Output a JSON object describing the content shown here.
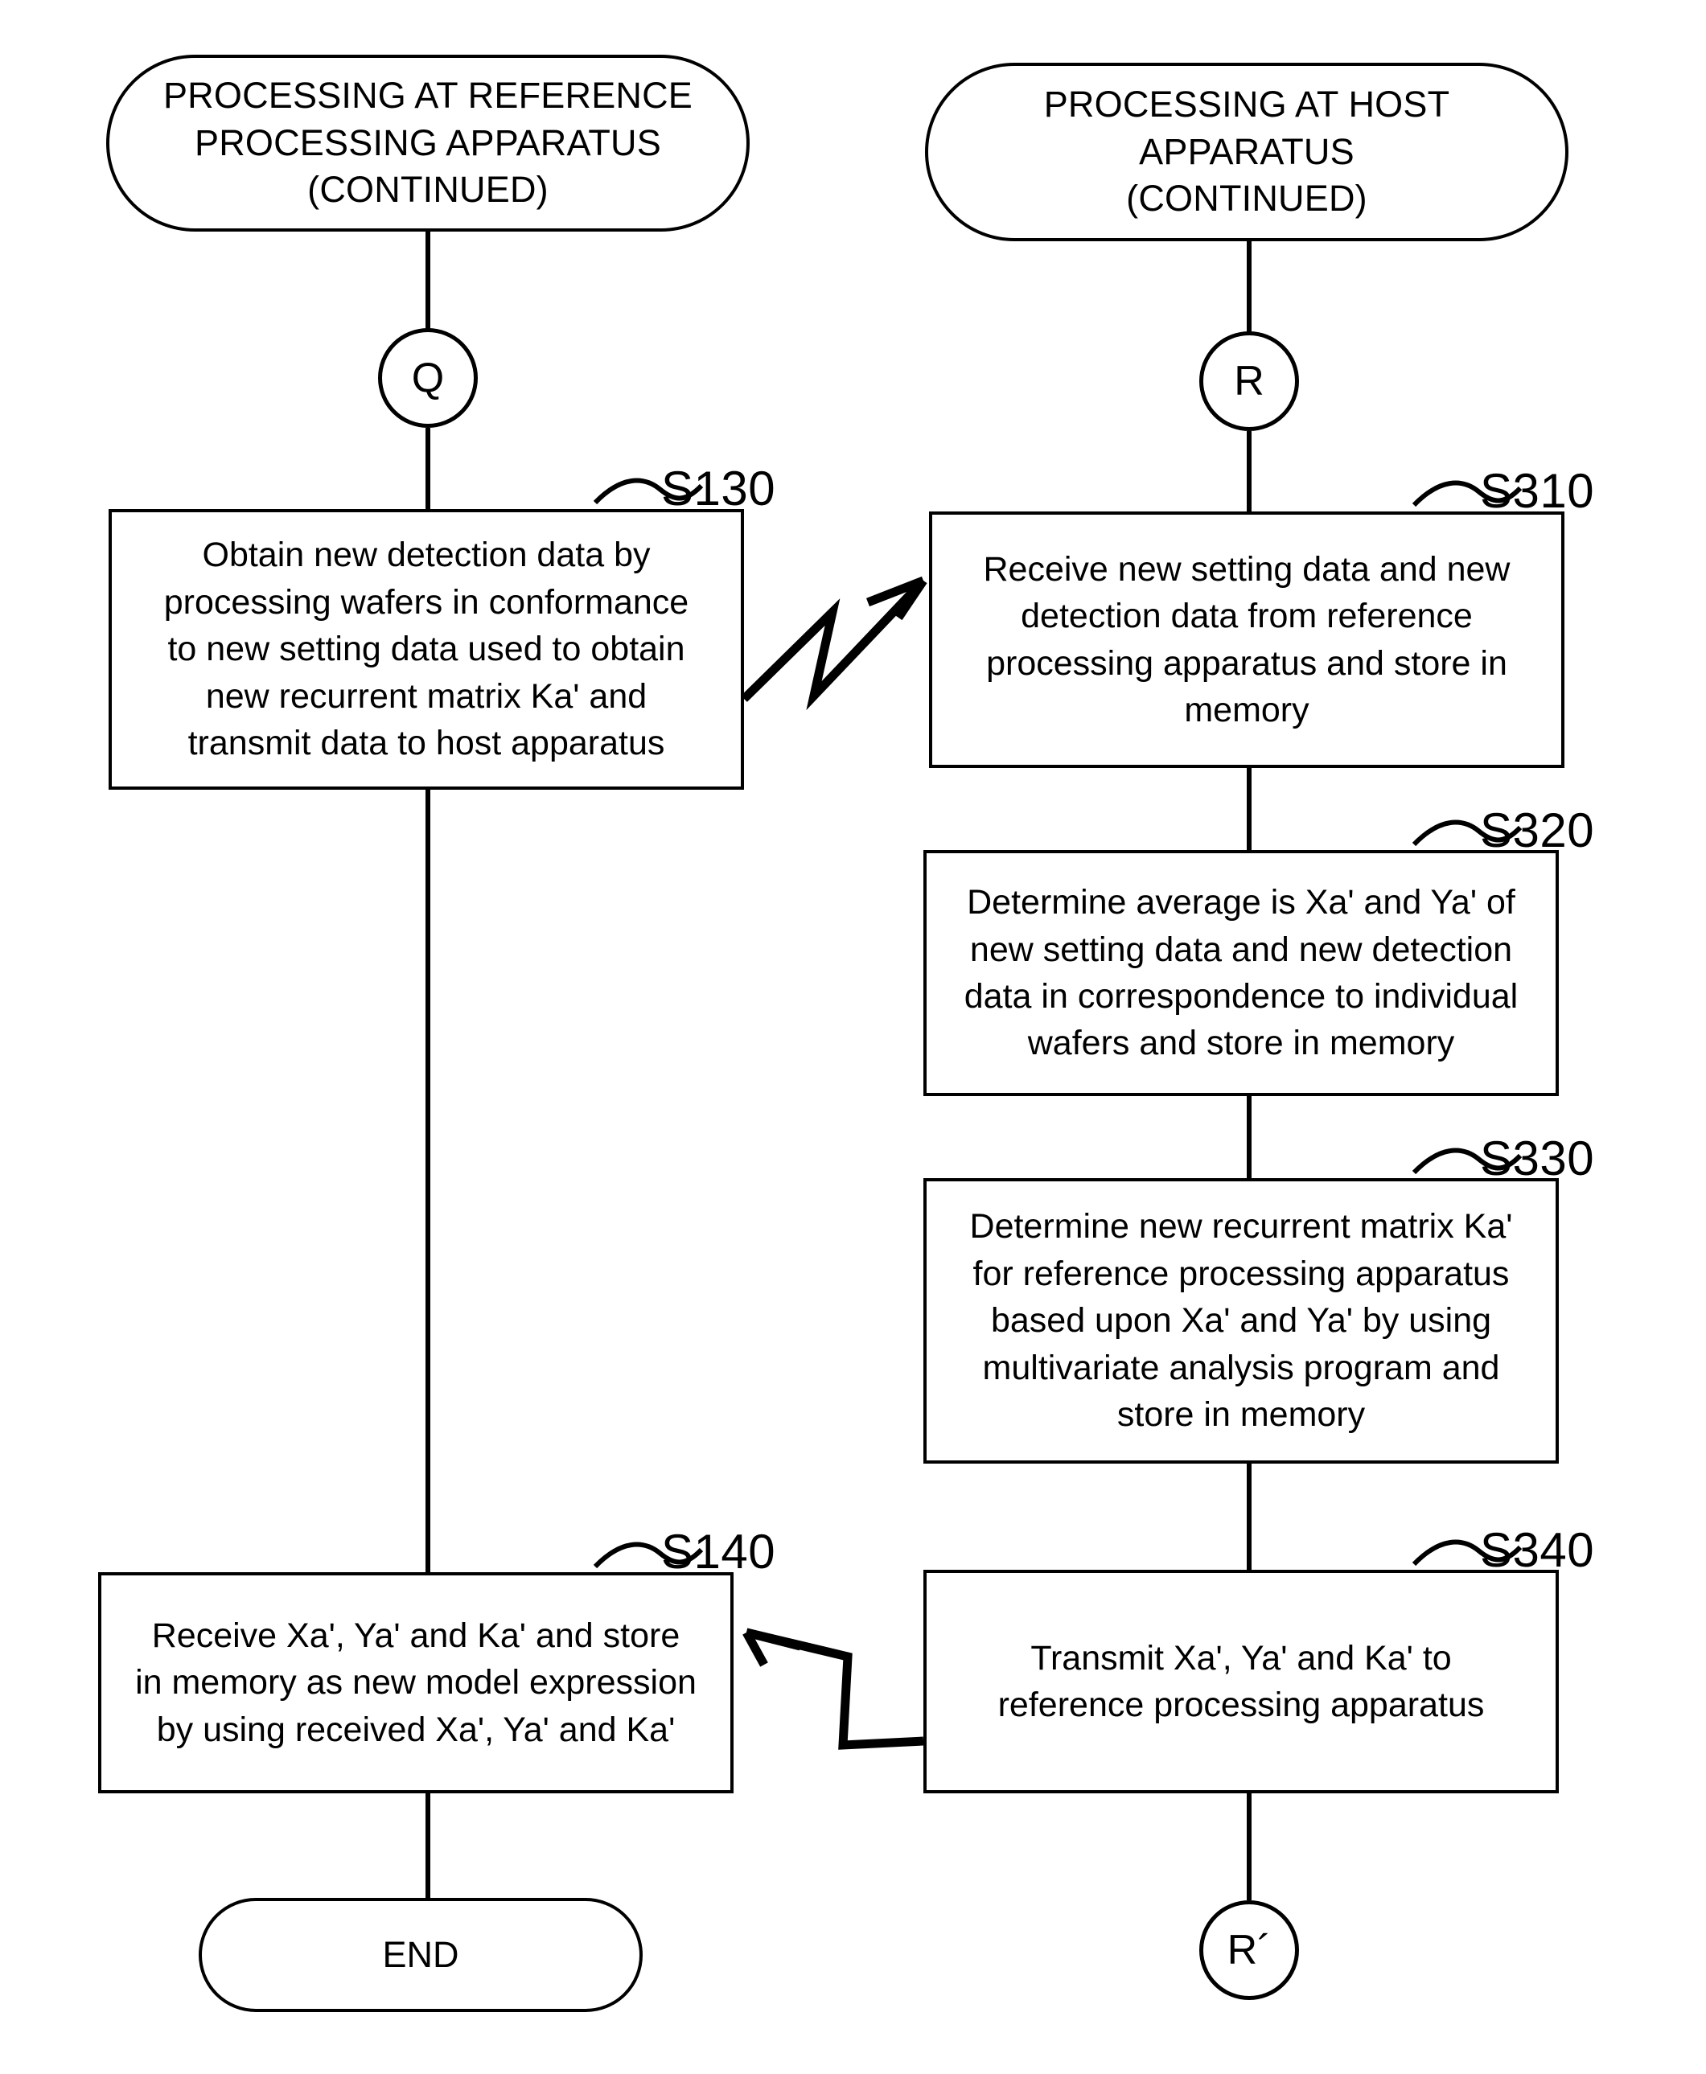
{
  "diagram": {
    "title_left": "PROCESSING AT REFERENCE PROCESSING APPARATUS (CONTINUED)",
    "title_right": "PROCESSING AT HOST APPARATUS (CONTINUED)",
    "line_color": "#000000",
    "background_color": "#ffffff"
  },
  "lanes": {
    "left": {
      "header": "PROCESSING AT REFERENCE\nPROCESSING APPARATUS\n(CONTINUED)",
      "connector_in": "Q",
      "terminator_end": "END"
    },
    "right": {
      "header": "PROCESSING AT HOST\nAPPARATUS\n(CONTINUED)",
      "connector_in": "R",
      "connector_out": "R´"
    }
  },
  "steps": [
    {
      "id": "S130",
      "label": "S130",
      "lane": "left",
      "text": "Obtain new detection data by\nprocessing wafers in conformance\nto new setting data used to obtain\nnew recurrent matrix Ka' and\ntransmit data to host apparatus"
    },
    {
      "id": "S310",
      "label": "S310",
      "lane": "right",
      "text": "Receive new setting data and new\ndetection data from reference\nprocessing apparatus and store in\nmemory"
    },
    {
      "id": "S320",
      "label": "S320",
      "lane": "right",
      "text": "Determine average is Xa' and Ya' of\nnew setting data and new detection\ndata in correspondence to individual\nwafers and store in memory"
    },
    {
      "id": "S330",
      "label": "S330",
      "lane": "right",
      "text": "Determine new recurrent matrix Ka'\nfor reference processing apparatus\nbased upon Xa' and Ya' by using\nmultivariate analysis program and\nstore in memory"
    },
    {
      "id": "S140",
      "label": "S140",
      "lane": "left",
      "text": "Receive Xa', Ya' and Ka' and store\nin memory as new model expression\nby using received Xa', Ya' and Ka'"
    },
    {
      "id": "S340",
      "label": "S340",
      "lane": "right",
      "text": "Transmit Xa', Ya' and Ka' to\nreference processing apparatus"
    }
  ],
  "flows": [
    {
      "name": "s130-to-s310",
      "kind": "zigzag-arrow",
      "direction": "left-to-right"
    },
    {
      "name": "s340-to-s140",
      "kind": "zigzag-arrow",
      "direction": "right-to-left"
    }
  ]
}
